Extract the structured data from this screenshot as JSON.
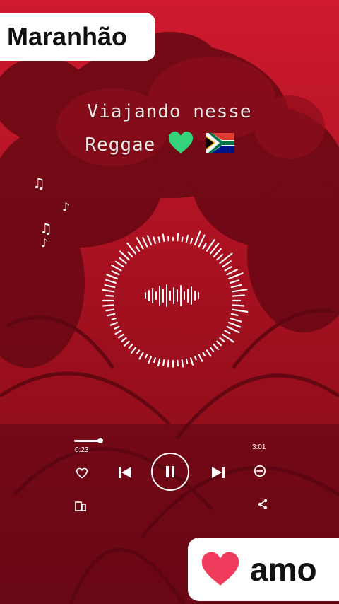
{
  "labels": {
    "location": "Maranhão",
    "love_text": "amo"
  },
  "caption": {
    "line1": "Viajando nesse",
    "line2": "Reggae"
  },
  "player": {
    "elapsed": "0:23",
    "duration": "3:01",
    "progress_fraction": 0.13,
    "state": "playing"
  },
  "icons": {
    "heart": "heart-icon",
    "green_heart": "green-heart-icon",
    "flag": "south-africa-flag-icon",
    "notes": "music-notes-icon",
    "like": "like-heart-outline-icon",
    "previous": "skip-previous-icon",
    "pause": "pause-icon",
    "next": "skip-next-icon",
    "minus": "minus-circle-icon",
    "device": "device-icon",
    "share": "share-icon"
  },
  "colors": {
    "background": "#b0101f",
    "foliage": "#6a0914",
    "white": "#ffffff"
  }
}
